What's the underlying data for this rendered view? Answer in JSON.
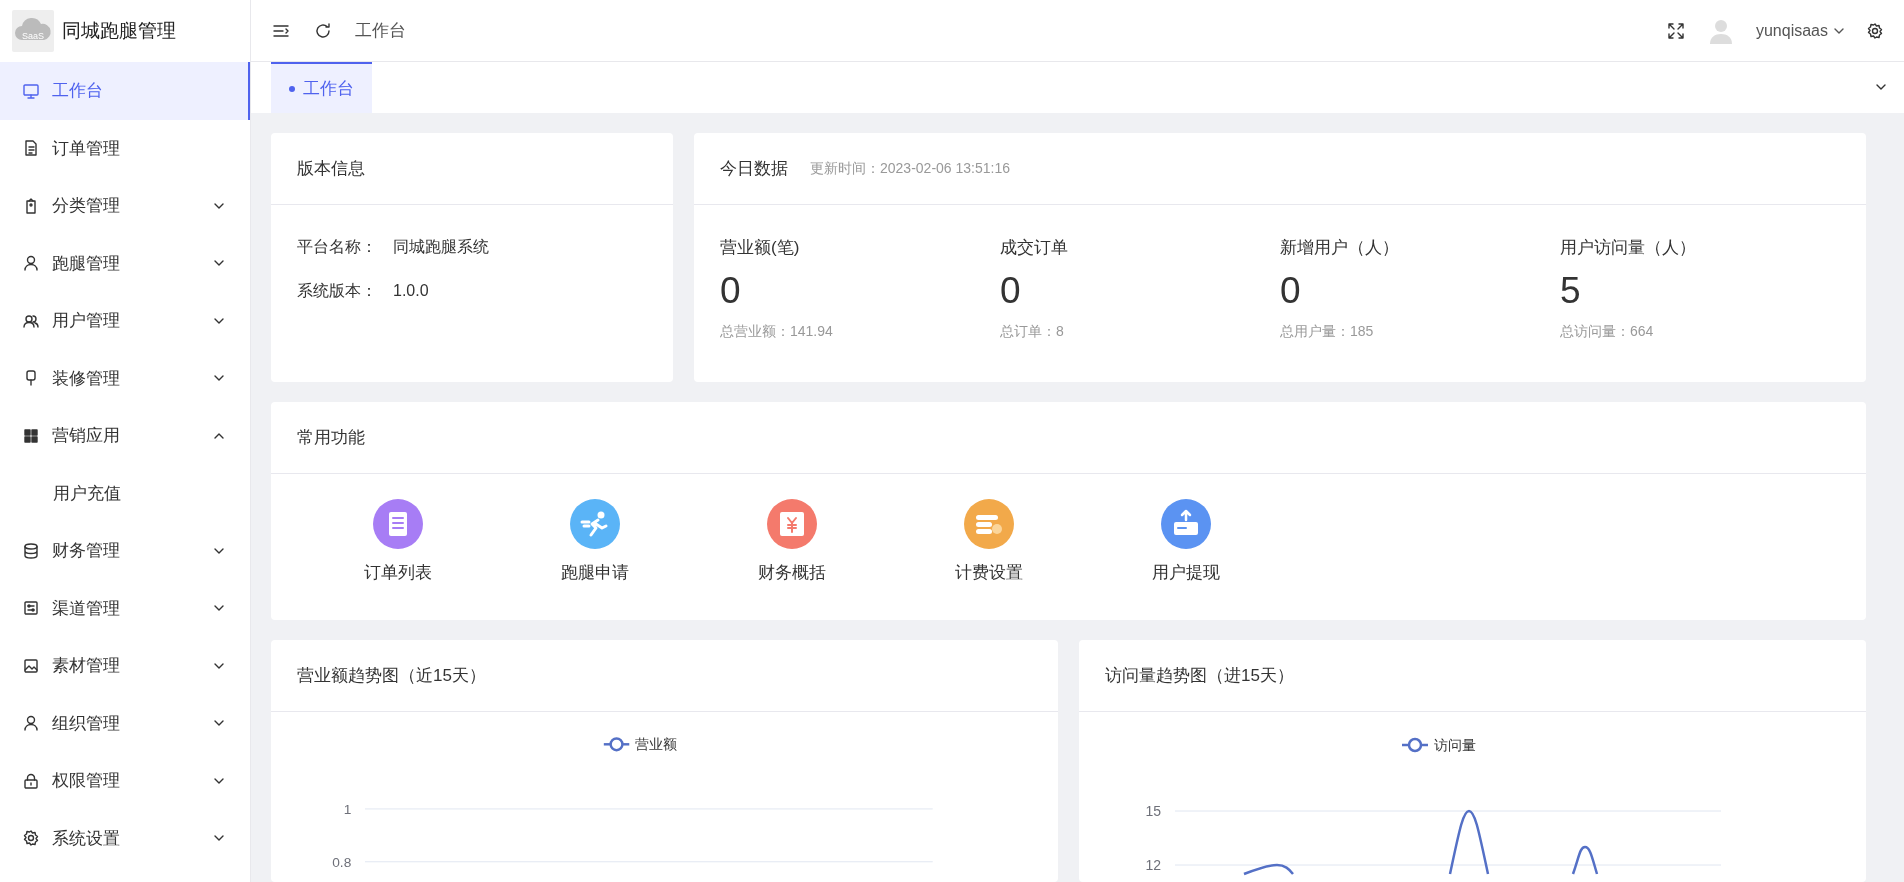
{
  "brand": {
    "logo_text": "SaaS",
    "title": "同城跑腿管理"
  },
  "sidebar": {
    "items": [
      {
        "label": "工作台",
        "selected": true
      },
      {
        "label": "订单管理",
        "selected": false
      },
      {
        "label": "分类管理",
        "selected": false,
        "expanded": false
      },
      {
        "label": "跑腿管理",
        "selected": false,
        "expanded": false
      },
      {
        "label": "用户管理",
        "selected": false,
        "expanded": false
      },
      {
        "label": "装修管理",
        "selected": false,
        "expanded": false
      },
      {
        "label": "营销应用",
        "selected": false,
        "expanded": true,
        "children": [
          {
            "label": "用户充值",
            "selected": false
          }
        ]
      },
      {
        "label": "财务管理",
        "selected": false,
        "expanded": false
      },
      {
        "label": "渠道管理",
        "selected": false,
        "expanded": false
      },
      {
        "label": "素材管理",
        "selected": false,
        "expanded": false
      },
      {
        "label": "组织管理",
        "selected": false,
        "expanded": false
      },
      {
        "label": "权限管理",
        "selected": false,
        "expanded": false
      },
      {
        "label": "系统设置",
        "selected": false,
        "expanded": false
      }
    ]
  },
  "header": {
    "breadcrumb": "工作台",
    "username": "yunqisaas"
  },
  "tabs": [
    {
      "label": "工作台",
      "selected": true
    }
  ],
  "version_card": {
    "title": "版本信息",
    "rows": [
      {
        "label": "平台名称：",
        "value": "同城跑腿系统"
      },
      {
        "label": "系统版本：",
        "value": "1.0.0"
      }
    ]
  },
  "today_card": {
    "title": "今日数据",
    "updated": "更新时间：2023-02-06 13:51:16",
    "stats": [
      {
        "label": "营业额(笔)",
        "value": "0",
        "total": "总营业额：141.94"
      },
      {
        "label": "成交订单",
        "value": "0",
        "total": "总订单：8"
      },
      {
        "label": "新增用户（人）",
        "value": "0",
        "total": "总用户量：185"
      },
      {
        "label": "用户访问量（人）",
        "value": "5",
        "total": "总访问量：664"
      }
    ]
  },
  "functions_card": {
    "title": "常用功能",
    "items": [
      {
        "label": "订单列表",
        "color": "#a77df5"
      },
      {
        "label": "跑腿申请",
        "color": "#5ab4f7"
      },
      {
        "label": "财务概括",
        "color": "#f47a6c"
      },
      {
        "label": "计费设置",
        "color": "#f2a94a"
      },
      {
        "label": "用户提现",
        "color": "#5b93f2"
      }
    ]
  },
  "charts": [
    {
      "title": "营业额趋势图（近15天）",
      "legend": "营业额",
      "yticks": [
        "1",
        "0.8"
      ]
    },
    {
      "title": "访问量趋势图（进15天）",
      "legend": "访问量",
      "yticks": [
        "15",
        "12"
      ]
    }
  ]
}
